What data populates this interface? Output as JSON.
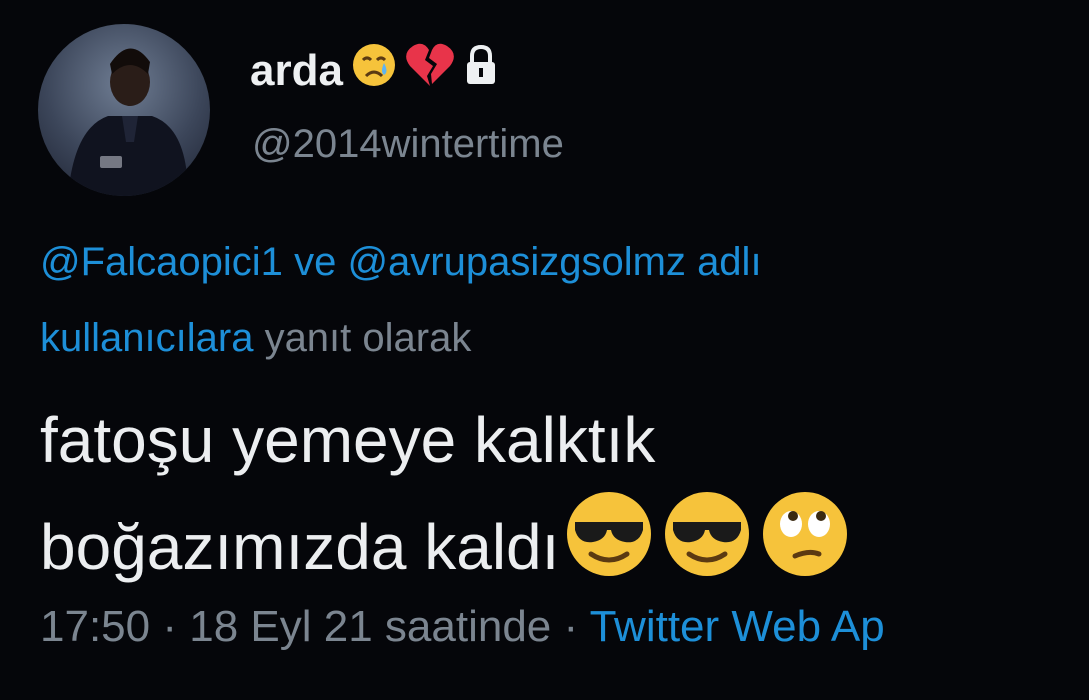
{
  "profile": {
    "display_name": "arda",
    "handle": "@2014wintertime",
    "name_icons": [
      "crying-face-emoji",
      "broken-heart-emoji",
      "lock-icon"
    ]
  },
  "reply": {
    "mention_1": "@Falcaopici1",
    "connector": "ve",
    "mention_2": "@avrupasizgsolmz",
    "adli": "adlı",
    "kullanicilara": "kullanıcılara",
    "suffix": "yanıt olarak"
  },
  "tweet": {
    "line1": "fatoşu yemeye kalktık",
    "line2": "boğazımızda kaldı",
    "emojis": [
      "sunglasses-emoji",
      "sunglasses-emoji",
      "eye-roll-emoji"
    ]
  },
  "meta": {
    "time": "17:50",
    "separator1": "·",
    "date": "18 Eyl 21 saatinde",
    "separator2": "·",
    "source": "Twitter Web Ap"
  },
  "colors": {
    "background": "#05060a",
    "link": "#1d8fd8",
    "secondary": "#7b8590",
    "text": "#eceef0"
  }
}
